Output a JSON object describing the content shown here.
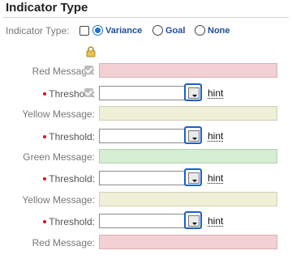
{
  "section": {
    "title": "Indicator Type"
  },
  "indicator_type": {
    "label": "Indicator Type:",
    "options": [
      {
        "label": "Variance",
        "selected": true
      },
      {
        "label": "Goal",
        "selected": false
      },
      {
        "label": "None",
        "selected": false
      }
    ]
  },
  "icons": {
    "lock": "lock-icon",
    "picker": "picker-icon"
  },
  "colors": {
    "red_message": "#f2d0d3",
    "yellow_message": "#eef0d7",
    "green_message": "#d6eed3",
    "accent": "#1a5fd0",
    "required_dot": "#dd1111"
  },
  "rows": {
    "red_message_1": {
      "label": "Red Message:"
    },
    "threshold_1": {
      "label": "Threshold:",
      "value": "",
      "hint": "hint"
    },
    "yellow_message_1": {
      "label": "Yellow Message:"
    },
    "threshold_2": {
      "label": "Threshold:",
      "value": "",
      "hint": "hint"
    },
    "green_message": {
      "label": "Green Message:"
    },
    "threshold_3": {
      "label": "Threshold:",
      "value": "",
      "hint": "hint"
    },
    "yellow_message_2": {
      "label": "Yellow Message:"
    },
    "threshold_4": {
      "label": "Threshold:",
      "value": "",
      "hint": "hint"
    },
    "red_message_2": {
      "label": "Red Message:"
    }
  }
}
